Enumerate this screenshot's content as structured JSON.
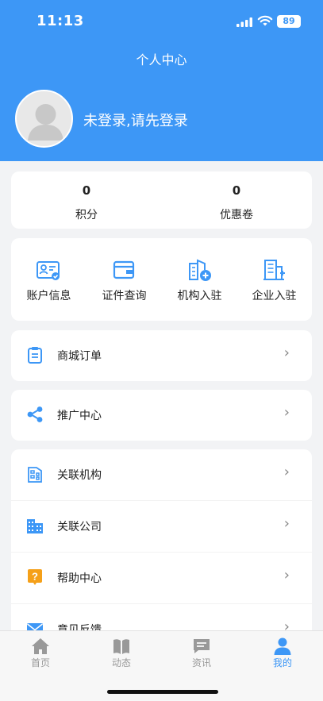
{
  "status_bar": {
    "time": "11:13",
    "battery": "89"
  },
  "header": {
    "title": "个人中心",
    "login_prompt": "未登录,请先登录"
  },
  "stats": [
    {
      "value": "0",
      "label": "积分"
    },
    {
      "value": "0",
      "label": "优惠卷"
    }
  ],
  "quick_actions": [
    {
      "label": "账户信息",
      "icon": "account-card-icon"
    },
    {
      "label": "证件查询",
      "icon": "wallet-icon"
    },
    {
      "label": "机构入驻",
      "icon": "building-add-icon"
    },
    {
      "label": "企业入驻",
      "icon": "office-add-icon"
    }
  ],
  "menu": {
    "orders": {
      "label": "商城订单",
      "icon": "clipboard-icon"
    },
    "promotion": {
      "label": "推广中心",
      "icon": "share-icon"
    },
    "items": [
      {
        "label": "关联机构",
        "icon": "institution-icon"
      },
      {
        "label": "关联公司",
        "icon": "company-icon"
      },
      {
        "label": "帮助中心",
        "icon": "help-icon"
      },
      {
        "label": "意见反馈",
        "icon": "mail-icon"
      }
    ]
  },
  "tabbar": [
    {
      "label": "首页",
      "icon": "home-icon"
    },
    {
      "label": "动态",
      "icon": "book-icon"
    },
    {
      "label": "资讯",
      "icon": "message-icon"
    },
    {
      "label": "我的",
      "icon": "user-icon",
      "active": true
    }
  ],
  "colors": {
    "primary": "#3d97f6",
    "help_orange": "#f5a019",
    "background": "#f2f3f5"
  }
}
